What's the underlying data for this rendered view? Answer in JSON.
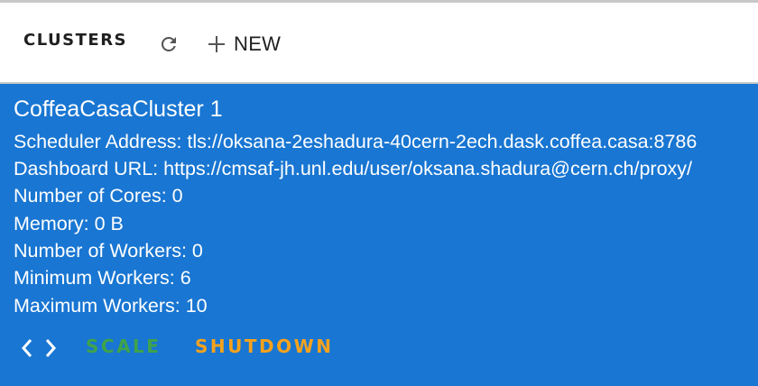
{
  "header": {
    "title": "CLUSTERS",
    "refresh_icon": "refresh-icon",
    "new_label": "NEW",
    "new_icon": "plus-icon"
  },
  "cluster": {
    "name": "CoffeaCasaCluster 1",
    "scheduler_address": "Scheduler Address: tls://oksana-2eshadura-40cern-2ech.dask.coffea.casa:8786",
    "dashboard_url": "Dashboard URL: https://cmsaf-jh.unl.edu/user/oksana.shadura@cern.ch/proxy/",
    "cores": "Number of Cores: 0",
    "memory": "Memory: 0 B",
    "workers": "Number of Workers: 0",
    "min_workers": "Minimum Workers: 6",
    "max_workers": "Maximum Workers: 10",
    "color": "#1976d2"
  },
  "actions": {
    "code_icon": "code-icon",
    "scale_label": "SCALE",
    "scale_color": "#3fa34a",
    "shutdown_label": "SHUTDOWN",
    "shutdown_color": "#f5a21d"
  }
}
